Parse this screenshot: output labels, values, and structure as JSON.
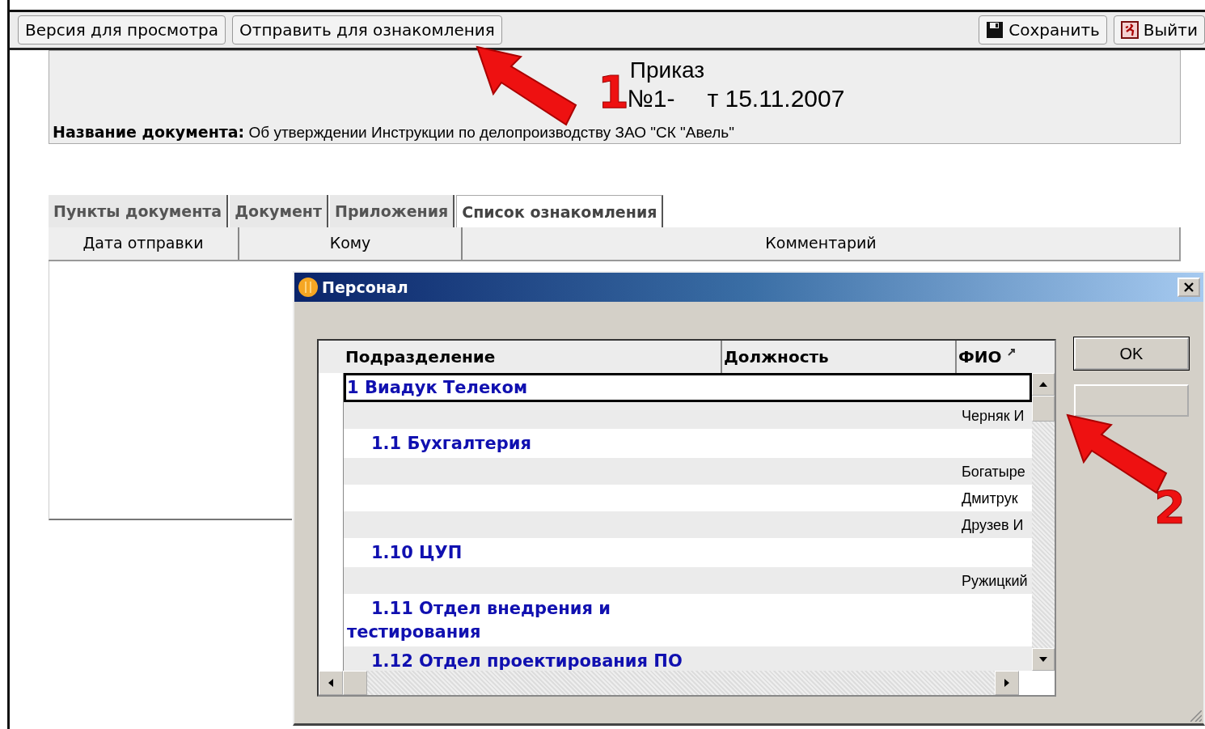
{
  "toolbar": {
    "left_buttons": [
      "Версия для просмотра",
      "Отправить для ознакомления"
    ],
    "right_buttons": [
      {
        "label": "Сохранить",
        "kind": "save"
      },
      {
        "label": "Выйти",
        "kind": "exit"
      }
    ]
  },
  "document": {
    "title": "Приказ",
    "number_parts": [
      "№1-",
      "т 15.11.2007"
    ],
    "name_label": "Название документа:",
    "name_value": "Об утверждении Инструкции по делопроизводству ЗАО \"СК \"Авель\""
  },
  "tabs": [
    {
      "label": "Пункты документа",
      "selected": false
    },
    {
      "label": "Документ",
      "selected": false
    },
    {
      "label": "Приложения",
      "selected": false
    },
    {
      "label": "Список ознакомления",
      "selected": true
    }
  ],
  "table": {
    "columns": [
      "Дата отправки",
      "Кому",
      "Комментарий"
    ]
  },
  "dialog": {
    "title": "Персонал",
    "columns": [
      "Подразделение",
      "Должность",
      "ФИО"
    ],
    "rows": [
      {
        "kind": "department",
        "text": "1 Виадук Телеком",
        "selected": true
      },
      {
        "kind": "person",
        "fio": "Черняк И",
        "selected": false
      },
      {
        "kind": "department",
        "text": "1.1 Бухгалтерия",
        "selected": false
      },
      {
        "kind": "person",
        "fio": "Богатыре",
        "selected": false
      },
      {
        "kind": "person",
        "fio": "Дмитрук",
        "selected": false
      },
      {
        "kind": "person",
        "fio": "Друзев И",
        "selected": false
      },
      {
        "kind": "department",
        "text": "1.10 ЦУП",
        "selected": false
      },
      {
        "kind": "person",
        "fio": "Ружицкий",
        "selected": false
      },
      {
        "kind": "department",
        "text": "1.11 Отдел внедрения и тестирования",
        "selected": false
      },
      {
        "kind": "department",
        "text": "1.12 Отдел проектирования ПО",
        "selected": false
      }
    ],
    "buttons": [
      "OK"
    ]
  },
  "annotations": [
    {
      "number": "1"
    },
    {
      "number": "2"
    }
  ]
}
